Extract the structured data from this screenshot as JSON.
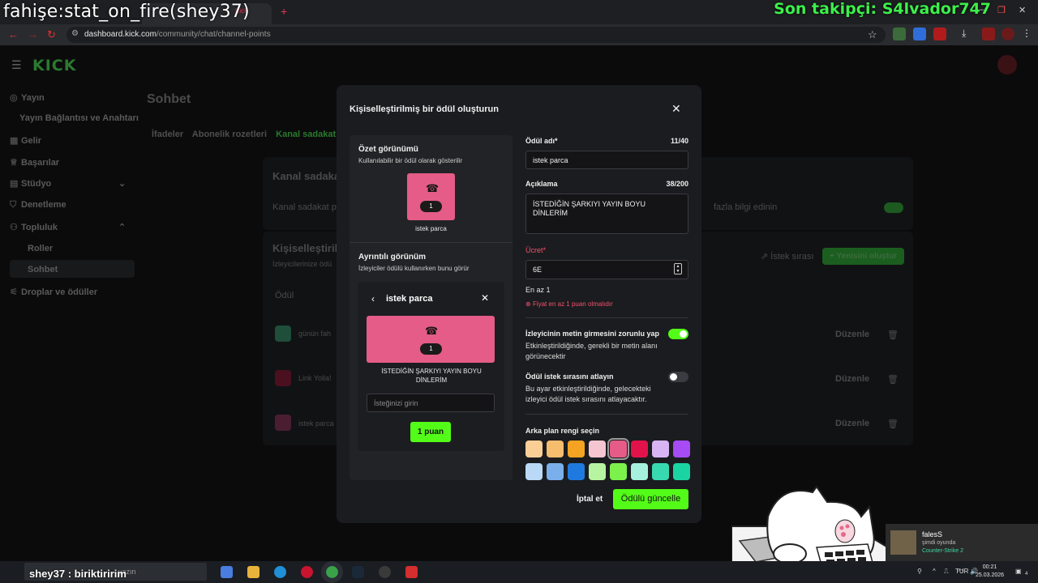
{
  "overlay": {
    "title": "fahişe:stat_on_fire(shey37)",
    "follower": "Son takipçi: S4lvador747",
    "chat": "shey37 : biriktiririm"
  },
  "browser": {
    "url_host": "dashboard.kick.com",
    "url_path": "/community/chat/channel-points"
  },
  "sidebar": {
    "items": [
      {
        "icon": "broadcast-icon",
        "label": "Yayın"
      },
      {
        "icon": "",
        "label": "Yayın Bağlantısı ve Anahtarı"
      },
      {
        "icon": "income-icon",
        "label": "Gelir"
      },
      {
        "icon": "trophy-icon",
        "label": "Başarılar"
      },
      {
        "icon": "studio-icon",
        "label": "Stüdyo"
      },
      {
        "icon": "shield-icon",
        "label": "Denetleme"
      },
      {
        "icon": "community-icon",
        "label": "Topluluk"
      },
      {
        "icon": "",
        "label": "Roller"
      },
      {
        "icon": "",
        "label": "Sohbet"
      },
      {
        "icon": "drops-icon",
        "label": "Droplar ve ödüller"
      }
    ]
  },
  "page": {
    "title": "Sohbet",
    "tabs": [
      "İfadeler",
      "Abonelik rozetleri",
      "Kanal sadakat puanları"
    ],
    "loyalty_heading": "Kanal sadakat",
    "loyalty_text": "Kanal sadakat pu",
    "more_info": "fazla bilgi edinin",
    "custom_heading": "Kişiselleştirilm",
    "custom_sub": "İzleyicilerinize ödü",
    "queue_label": "İstek sırası",
    "create_new": "Yenisini oluştur",
    "col_reward": "Ödül",
    "rows": [
      "günün fah",
      "Link Yolla!",
      "istek parca"
    ],
    "edit_label": "Düzenle"
  },
  "modal": {
    "title": "Kişiselleştirilmiş bir ödül oluşturun",
    "summary_heading": "Özet görünümü",
    "summary_sub": "Kullanılabilir bir ödül olarak gösterilir",
    "reward_cost": "1",
    "reward_name": "istek parca",
    "detail_heading": "Ayrıntılı görünüm",
    "detail_sub": "İzleyiciler ödülü kullanırken bunu görür",
    "detail_desc": "İSTEDİĞİN ŞARKIYI YAYIN BOYU DİNLERİM",
    "request_placeholder": "İsteğinizi girin",
    "points_button": "1 puan",
    "name_label": "Ödül adı*",
    "name_count": "11/40",
    "name_value": "istek parca",
    "desc_label": "Açıklama",
    "desc_count": "38/200",
    "desc_value": "İSTEDİĞİN ŞARKIYI YAYIN BOYU DİNLERİM",
    "cost_label": "Ücret*",
    "cost_value": "6E",
    "min_hint": "En az 1",
    "cost_error": "Fiyat en az 1 puan olmalıdır",
    "require_text_label": "İzleyicinin metin girmesini zorunlu yap",
    "require_text_on": true,
    "require_text_help": "Etkinleştirildiğinde, gerekli bir metin alanı görünecektir",
    "skip_queue_label": "Ödül istek sırasını atlayın",
    "skip_queue_on": false,
    "skip_queue_help": "Bu ayar etkinleştirildiğinde, gelecekteki izleyici ödül istek sırasını atlayacaktır.",
    "color_label": "Arka plan rengi seçin",
    "selected_color": "#e45c87",
    "colors": [
      "#f9cf96",
      "#f6bd6e",
      "#f4a322",
      "#f5c6d2",
      "#e45c87",
      "#e2134b",
      "#d7b5f4",
      "#a74bf4",
      "#b9d9f6",
      "#79afea",
      "#1f7ae0",
      "#b7f4a1",
      "#7cf14c",
      "#a5f1dd",
      "#38d9b1",
      "#1bd4a4"
    ],
    "cancel": "İptal et",
    "submit": "Ödülü güncelle"
  },
  "notification": {
    "user": "falesS",
    "status": "şimdi oyunda",
    "game": "Counter-Strike 2"
  },
  "taskbar": {
    "search_placeholder": "yazın",
    "lang": "TUR",
    "time": "00:21",
    "date": "25.03.2026",
    "notif_count": "4"
  },
  "colors": {
    "accent": "#53fc18",
    "modal_bg": "#1b1c1f",
    "error": "#f2526f"
  }
}
